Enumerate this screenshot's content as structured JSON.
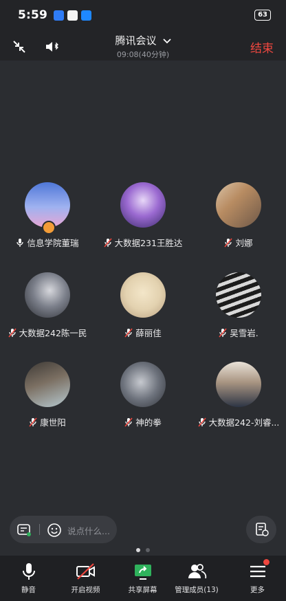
{
  "status": {
    "time": "5:59",
    "battery": "63"
  },
  "header": {
    "title": "腾讯会议",
    "duration": "09:08(40分钟)",
    "end_label": "结束"
  },
  "participants": [
    {
      "name": "信息学院董瑞",
      "mic": "on",
      "host": true,
      "avatar_bg": "#5d79c4"
    },
    {
      "name": "大数据231王胜达",
      "mic": "off",
      "host": false,
      "avatar_bg": "#7a5ab4"
    },
    {
      "name": "刘娜",
      "mic": "off",
      "host": false,
      "avatar_bg": "#b49070"
    },
    {
      "name": "大数据242陈一民",
      "mic": "off",
      "host": false,
      "avatar_bg": "#555a66"
    },
    {
      "name": "薛丽佳",
      "mic": "off",
      "host": false,
      "avatar_bg": "#d7c8a2"
    },
    {
      "name": "吴雪岩.",
      "mic": "off",
      "host": false,
      "avatar_bg": "#4b4b4b"
    },
    {
      "name": "康世阳",
      "mic": "off",
      "host": false,
      "avatar_bg": "#7a6b5b"
    },
    {
      "name": "神的拳",
      "mic": "off",
      "host": false,
      "avatar_bg": "#5c6068"
    },
    {
      "name": "大数据242-刘睿...",
      "mic": "off",
      "host": false,
      "avatar_bg": "#8a7a66"
    }
  ],
  "chat": {
    "placeholder": "说点什么..."
  },
  "toolbar": {
    "mute": "静音",
    "video": "开启视频",
    "share": "共享屏幕",
    "members": "管理成员(13)",
    "more": "更多"
  },
  "colors": {
    "accent_red": "#f0473f",
    "share_green": "#2fb25c",
    "host_orange": "#f29c38"
  }
}
